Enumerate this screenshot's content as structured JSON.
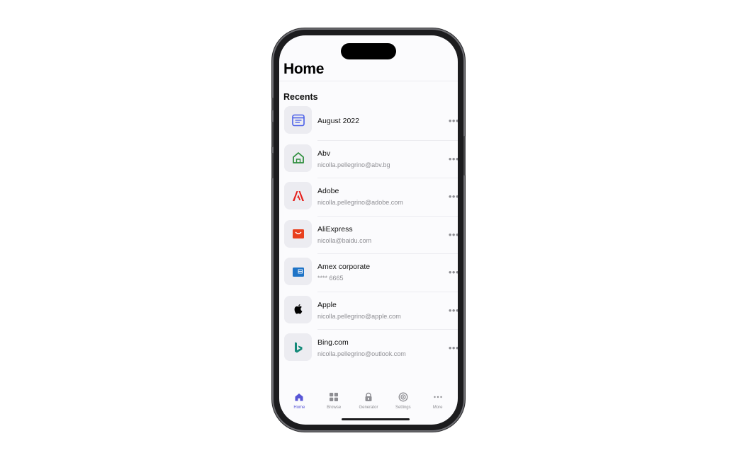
{
  "app": {
    "title": "Home",
    "section_title": "Recents"
  },
  "items": [
    {
      "name": "August 2022",
      "subtitle": "",
      "icon": "calendar-note-icon",
      "more": "•••"
    },
    {
      "name": "Abv",
      "subtitle": "nicolla.pellegrino@abv.bg",
      "icon": "abv-house-icon",
      "more": "•••"
    },
    {
      "name": "Adobe",
      "subtitle": "nicolla.pellegrino@adobe.com",
      "icon": "adobe-logo-icon",
      "more": "•••"
    },
    {
      "name": "AliExpress",
      "subtitle": "nicolla@baidu.com",
      "icon": "aliexpress-bag-icon",
      "more": "•••"
    },
    {
      "name": "Amex corporate",
      "subtitle": "**** 6665",
      "icon": "amex-card-icon",
      "more": "•••"
    },
    {
      "name": "Apple",
      "subtitle": "nicolla.pellegrino@apple.com",
      "icon": "apple-logo-icon",
      "more": "•••"
    },
    {
      "name": "Bing.com",
      "subtitle": "nicolla.pellegrino@outlook.com",
      "icon": "bing-logo-icon",
      "more": "•••"
    }
  ],
  "tabbar": {
    "tabs": [
      {
        "label": "Home",
        "icon": "house-icon",
        "active": true
      },
      {
        "label": "Browse",
        "icon": "grid-icon",
        "active": false
      },
      {
        "label": "Generator",
        "icon": "lock-icon",
        "active": false
      },
      {
        "label": "Settings",
        "icon": "gear-icon",
        "active": false
      },
      {
        "label": "More",
        "icon": "ellipsis-icon",
        "active": false
      }
    ]
  },
  "colors": {
    "accent": "#5856d6",
    "adobe_red": "#e61f1b",
    "aliexpress_red": "#e8401e",
    "amex_blue": "#1f74c7",
    "bing_teal": "#148a79",
    "abv_green": "#2f8f3e"
  }
}
